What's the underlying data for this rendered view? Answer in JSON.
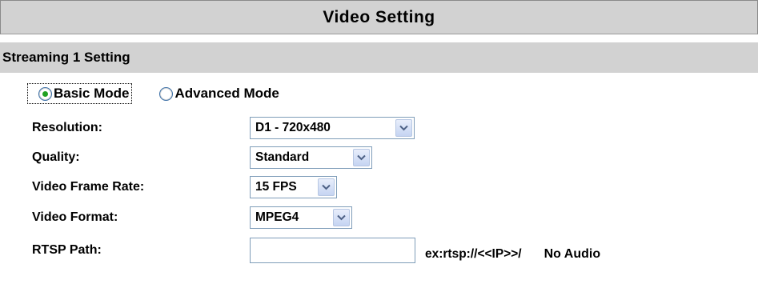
{
  "title": "Video Setting",
  "section": "Streaming 1 Setting",
  "modes": [
    {
      "label": "Basic Mode",
      "checked": true
    },
    {
      "label": "Advanced Mode",
      "checked": false
    }
  ],
  "settings": {
    "resolution": {
      "label": "Resolution:",
      "value": "D1 - 720x480"
    },
    "quality": {
      "label": "Quality:",
      "value": "Standard"
    },
    "frame_rate": {
      "label": "Video Frame Rate:",
      "value": "15 FPS"
    },
    "format": {
      "label": "Video Format:",
      "value": "MPEG4"
    },
    "rtsp": {
      "label": "RTSP Path:",
      "value": "",
      "hint": "ex:rtsp://<<IP>>/",
      "note": "No Audio"
    }
  },
  "icons": {
    "dropdown": "chevron-down-icon",
    "radio": "radio-icon"
  },
  "colors": {
    "header_bg": "#d2d2d2",
    "radio_selected": "#21a121",
    "arrow_bg": "#c5d4f2"
  }
}
